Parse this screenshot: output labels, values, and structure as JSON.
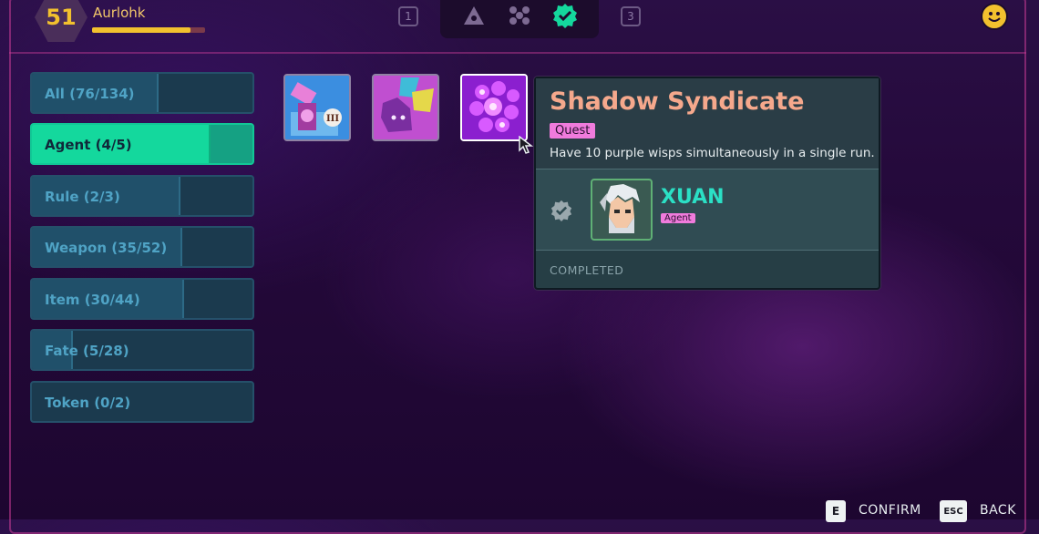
{
  "player": {
    "level": "51",
    "name": "Aurlohk",
    "xp_fraction": 0.87
  },
  "top_tabs": {
    "left_num": "1",
    "right_num": "3",
    "icons": [
      "triangle-eye-icon",
      "nodes-icon",
      "check-badge-icon"
    ],
    "active": 2
  },
  "categories": [
    {
      "label": "All (76/134)",
      "progress": 0.567
    },
    {
      "label": "Agent (4/5)",
      "progress": 0.8,
      "active": true
    },
    {
      "label": "Rule (2/3)",
      "progress": 0.667
    },
    {
      "label": "Weapon (35/52)",
      "progress": 0.673
    },
    {
      "label": "Item (30/44)",
      "progress": 0.682
    },
    {
      "label": "Fate (5/28)",
      "progress": 0.179
    },
    {
      "label": "Token (0/2)",
      "progress": 0
    }
  ],
  "cards": [
    {
      "icon": "robot-arm-icon",
      "badge": "III"
    },
    {
      "icon": "purple-cat-icon"
    },
    {
      "icon": "purple-wisps-icon",
      "selected": true
    }
  ],
  "popup": {
    "title": "Shadow Syndicate",
    "tag": "Quest",
    "description": "Have 10 purple wisps simultaneously in a single run.",
    "agent_name": "XUAN",
    "agent_tag": "Agent",
    "status": "COMPLETED"
  },
  "hints": {
    "confirm_key": "E",
    "confirm_label": "CONFIRM",
    "back_key": "ESC",
    "back_label": "BACK"
  },
  "colors": {
    "accent": "#14d89d",
    "gold": "#f2c12e",
    "tag_pink": "#f07bdc",
    "title_peach": "#f5a88c",
    "agent_cyan": "#2be0c5"
  }
}
